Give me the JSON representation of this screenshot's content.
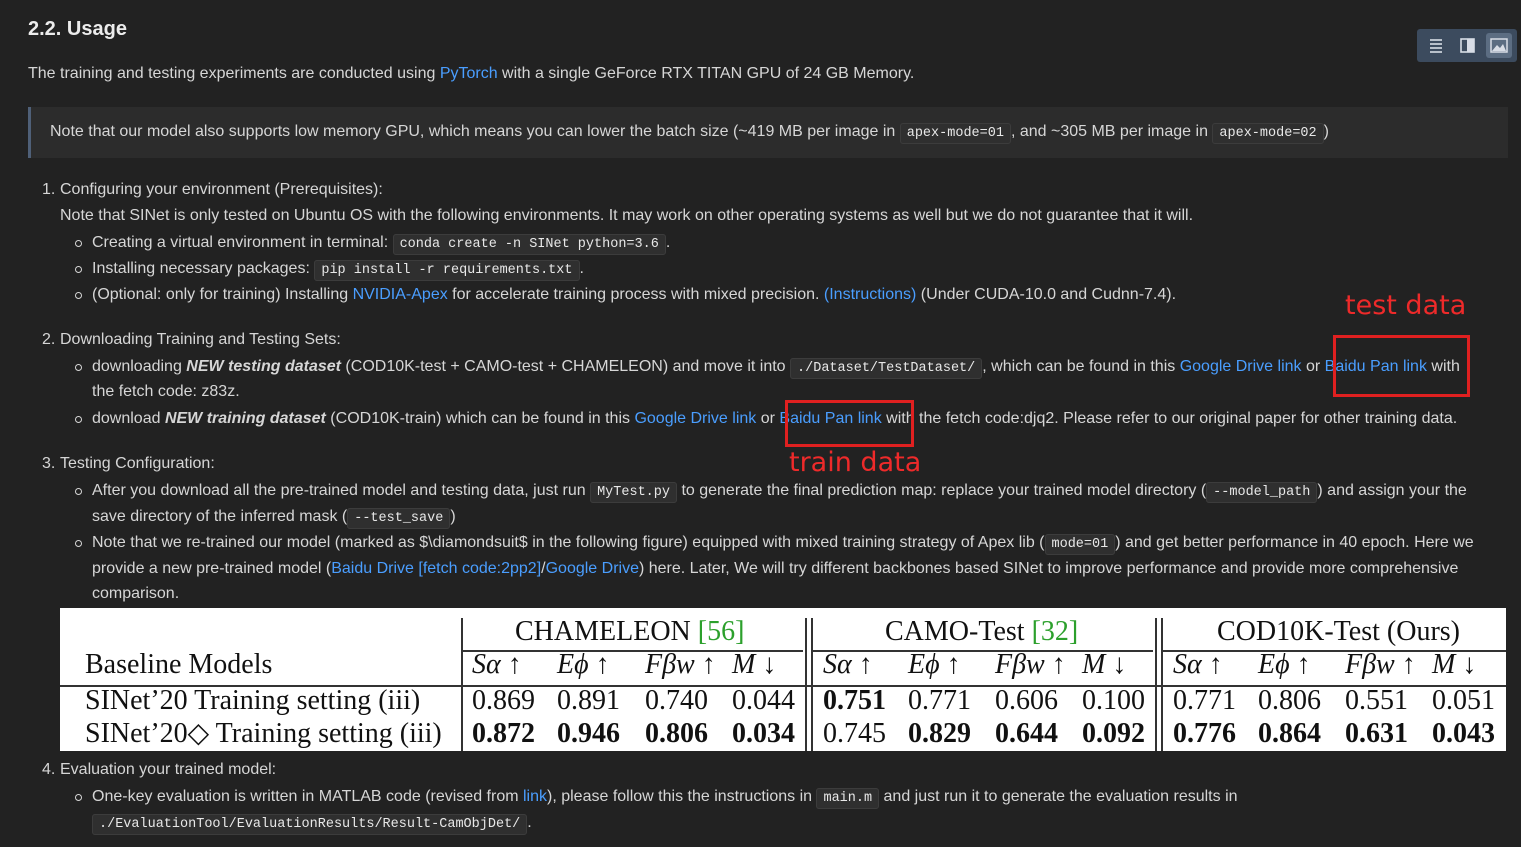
{
  "heading": "2.2. Usage",
  "toolbar": {
    "icons": [
      "list-icon",
      "split-view-icon",
      "image-icon"
    ]
  },
  "intro": {
    "before": "The training and testing experiments are conducted using ",
    "link": "PyTorch",
    "after": " with a single GeForce RTX TITAN GPU of 24 GB Memory."
  },
  "note": {
    "p1": "Note that our model also supports low memory GPU, which means you can lower the batch size (~419 MB per image in ",
    "c1": "apex-mode=01",
    "p2": ", and ~305 MB per image in ",
    "c2": "apex-mode=02",
    "p3": ")"
  },
  "step1": {
    "num": "1.",
    "title": "Configuring your environment (Prerequisites):",
    "desc": "Note that SINet is only tested on Ubuntu OS with the following environments. It may work on other operating systems as well but we do not guarantee that it will.",
    "b1": {
      "text": "Creating a virtual environment in terminal: ",
      "code": "conda create -n SINet python=3.6",
      "after": "."
    },
    "b2": {
      "text": "Installing necessary packages: ",
      "code": "pip install -r requirements.txt",
      "after": "."
    },
    "b3": {
      "text": "(Optional: only for training) Installing ",
      "link": "NVIDIA-Apex",
      "mid": " for accelerate training process with mixed precision. ",
      "link2": "(Instructions)",
      "after": " (Under CUDA-10.0 and Cudnn-7.4)."
    }
  },
  "step2": {
    "num": "2.",
    "title": "Downloading Training and Testing Sets:",
    "b1": {
      "p1": "downloading ",
      "em": "NEW testing dataset",
      "p2": " (COD10K-test + CAMO-test + CHAMELEON) and move it into ",
      "code": "./Dataset/TestDataset/",
      "p3": ", which can be found in this ",
      "link1": "Google Drive link",
      "p4": " or ",
      "link2": "Baidu Pan link",
      "p5": " with",
      "line2": "the fetch code: z83z."
    },
    "b2": {
      "p1": "download ",
      "em": "NEW training dataset",
      "p2": " (COD10K-train) which can be found in this ",
      "link1": "Google Drive link",
      "p3": " or ",
      "link2": "Baidu Pan link",
      "p4": " with the fetch code:djq2. Please refer to our original paper for other training data."
    }
  },
  "annotations": {
    "test": "test data",
    "train": "train data"
  },
  "step3": {
    "num": "3.",
    "title": "Testing Configuration:",
    "b1": {
      "p1": "After you download all the pre-trained model and testing data, just run ",
      "code1": "MyTest.py",
      "p2": " to generate the final prediction map: replace your trained model directory (",
      "code2": "--model_path",
      "p3": ") and assign your the",
      "l2a": "save directory of the inferred mask (",
      "code3": "--test_save",
      "l2b": ")"
    },
    "b2": {
      "p1": "Note that we re-trained our model (marked as $\\diamondsuit$ in the following figure) equipped with mixed training strategy of Apex lib (",
      "code": "mode=01",
      "p2": ") and get better performance in 40 epoch. Here we",
      "l2a": "provide a new pre-trained model (",
      "link1": "Baidu Drive",
      "l2b": " ",
      "link2": "[fetch code:2pp2]",
      "l2c": "/",
      "link3": "Google Drive",
      "l2d": ") here. Later, We will try different backbones based SINet to improve performance and provide more comprehensive",
      "l3": "comparison."
    }
  },
  "table": {
    "row_header": "Baseline Models",
    "groups": [
      {
        "name": "CHAMELEON ",
        "ref": "[56]"
      },
      {
        "name": "CAMO-Test ",
        "ref": "[32]"
      },
      {
        "name": "COD10K-Test (Ours)",
        "ref": ""
      }
    ],
    "metrics": [
      "Sα ↑",
      "Eϕ ↑",
      "Fβw ↑",
      "M ↓"
    ],
    "rows": [
      {
        "label": "SINet’20 Training setting (iii)",
        "values": [
          "0.869",
          "0.891",
          "0.740",
          "0.044",
          "0.751",
          "0.771",
          "0.606",
          "0.100",
          "0.771",
          "0.806",
          "0.551",
          "0.051"
        ],
        "bold": [
          false,
          false,
          false,
          false,
          true,
          false,
          false,
          false,
          false,
          false,
          false,
          false
        ]
      },
      {
        "label": "SINet’20◇ Training setting (iii)",
        "values": [
          "0.872",
          "0.946",
          "0.806",
          "0.034",
          "0.745",
          "0.829",
          "0.644",
          "0.092",
          "0.776",
          "0.864",
          "0.631",
          "0.043"
        ],
        "bold": [
          true,
          true,
          true,
          true,
          false,
          true,
          true,
          true,
          true,
          true,
          true,
          true
        ]
      }
    ]
  },
  "step4": {
    "num": "4.",
    "title": "Evaluation your trained model:",
    "b1": {
      "p1": "One-key evaluation is written in MATLAB code (revised from ",
      "link": "link",
      "p2": "), please follow this the instructions in ",
      "code": "main.m",
      "p3": " and just run it to generate the evaluation results in",
      "code2": "./EvaluationTool/EvaluationResults/Result-CamObjDet/",
      "after": "."
    }
  }
}
